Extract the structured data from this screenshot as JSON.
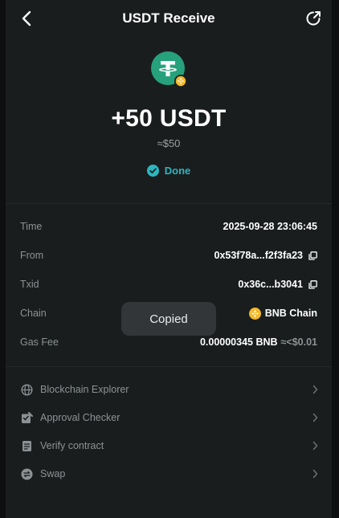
{
  "header": {
    "title": "USDT Receive"
  },
  "summary": {
    "amount": "+50 USDT",
    "fiat": "≈$50",
    "status": "Done"
  },
  "details": {
    "time": {
      "label": "Time",
      "value": "2025-09-28 23:06:45"
    },
    "from": {
      "label": "From",
      "value": "0x53f78a...f2f3fa23"
    },
    "txid": {
      "label": "Txid",
      "value": "0x36c...b3041"
    },
    "chain": {
      "label": "Chain",
      "value": "BNB Chain"
    },
    "gas_fee": {
      "label": "Gas Fee",
      "value": "0.00000345 BNB",
      "usd": "≈<$0.01"
    }
  },
  "toast": {
    "text": "Copied"
  },
  "menu": [
    {
      "label": "Blockchain Explorer",
      "icon": "globe-icon"
    },
    {
      "label": "Approval Checker",
      "icon": "approval-checker-icon"
    },
    {
      "label": "Verify contract",
      "icon": "verify-contract-icon"
    },
    {
      "label": "Swap",
      "icon": "swap-icon"
    }
  ],
  "colors": {
    "accent": "#2db6c1",
    "tether": "#26a17b",
    "bnb": "#f3ba2f",
    "background": "#1a1d1e"
  }
}
